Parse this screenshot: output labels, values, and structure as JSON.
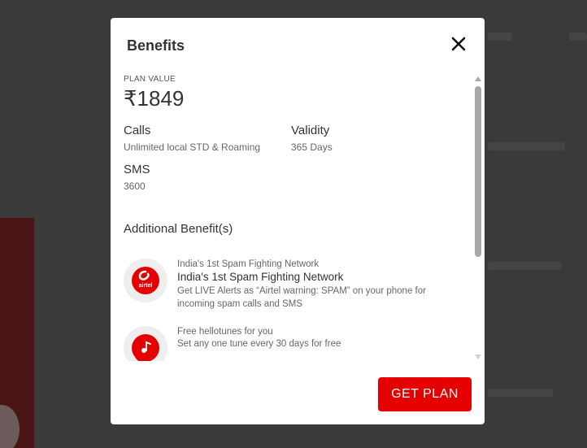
{
  "modal": {
    "title": "Benefits",
    "close_icon": "close-icon"
  },
  "plan": {
    "value_label": "PLAN VALUE",
    "value": "₹1849",
    "calls_label": "Calls",
    "calls_value": "Unlimited local STD & Roaming",
    "validity_label": "Validity",
    "validity_value": "365 Days",
    "sms_label": "SMS",
    "sms_value": "3600"
  },
  "additional": {
    "title": "Additional Benefit(s)",
    "items": [
      {
        "icon": "airtel-logo-icon",
        "icon_text": "airtel",
        "subtitle": "India's 1st Spam Fighting Network",
        "heading": "India's 1st Spam Fighting Network",
        "description": "Get LIVE Alerts as “Airtel warning: SPAM” on your phone for incoming spam calls and SMS"
      },
      {
        "icon": "hellotunes-icon",
        "subtitle": "Free hellotunes for you",
        "description": "Set any one tune every 30 days for free"
      }
    ]
  },
  "actions": {
    "get_plan_label": "GET PLAN"
  },
  "colors": {
    "accent": "#e40000",
    "overlay": "#3a3a3a",
    "text_primary": "#333333",
    "text_secondary": "#666666"
  }
}
